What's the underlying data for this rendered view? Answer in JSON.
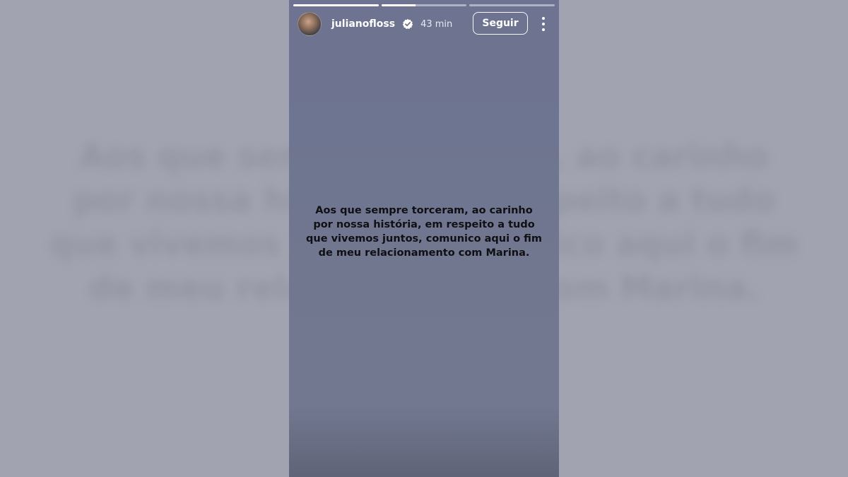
{
  "story": {
    "progress": [
      1.0,
      0.4,
      0.0
    ],
    "user": {
      "username": "julianofloss",
      "verified": true,
      "time_ago": "43 min",
      "avatar_icon": "profile-avatar"
    },
    "follow_label": "Seguir",
    "menu_icon": "more-vertical-icon",
    "message": "Aos que sempre torceram, ao carinho\npor nossa história, em respeito a tudo\nque vivemos juntos, comunico aqui o fim\nde meu relacionamento com Marina.",
    "background_color": "#6f7590",
    "text_color": "#101014"
  },
  "backdrop": {
    "blurred_message": "Aos que sempre torceram, ao carinho\npor nossa história, em respeito a tudo\nque vivemos juntos, comunico aqui o fim\nde meu relacionamento com Marina.",
    "background_color": "#a1a3b0"
  }
}
